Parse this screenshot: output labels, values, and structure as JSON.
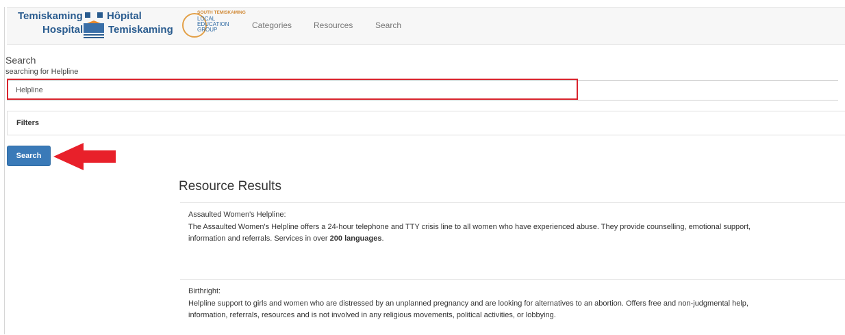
{
  "logo": {
    "english_top": "Temiskaming",
    "english_bottom": "Hospital",
    "french_top": "Hôpital",
    "french_bottom": "Temiskaming",
    "leg_top": "SOUTH TEMISKAMING",
    "leg_l1": "LOCAL",
    "leg_l2": "EDUCATION",
    "leg_l3": "GROUP"
  },
  "nav": {
    "categories": "Categories",
    "resources": "Resources",
    "search": "Search"
  },
  "search": {
    "heading": "Search",
    "subheading": "searching for Helpline",
    "input_value": "Helpline",
    "filters_label": "Filters",
    "button_label": "Search",
    "highlight_color": "#d9232d",
    "arrow_color": "#e8202a"
  },
  "results": {
    "title": "Resource Results",
    "items": [
      {
        "name": "Assaulted Women's Helpline:",
        "desc_line1": "The Assaulted Women's Helpline offers a 24-hour telephone and TTY crisis line to all women who have experienced abuse. They provide counselling, emotional support,",
        "desc_line2_a": "information and referrals. Services in over ",
        "desc_line2_b": "200 languages",
        "desc_line2_c": "."
      },
      {
        "name": "Birthright:",
        "desc_line1": "Helpline support to girls and women who are distressed by an unplanned pregnancy and are looking for alternatives to an abortion. Offers free and non-judgmental help,",
        "desc_line2": "information, referrals, resources and is not involved in any religious movements, political activities, or lobbying."
      }
    ]
  }
}
